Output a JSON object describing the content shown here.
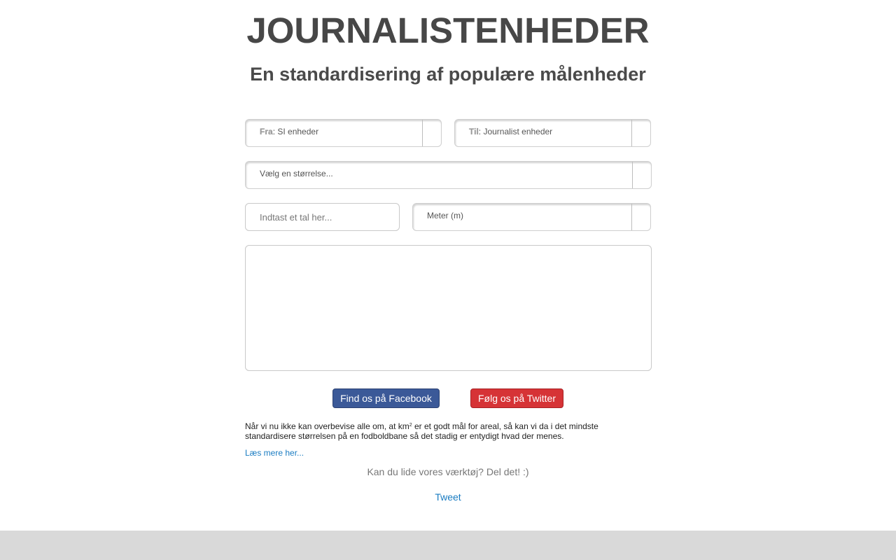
{
  "header": {
    "title": "JOURNALISTENHEDER",
    "subtitle": "En standardisering af populære målenheder"
  },
  "from_select": {
    "prefix": "Fra",
    "value": ": SI enheder"
  },
  "to_select": {
    "prefix": "Til",
    "value": ": Journalist enheder"
  },
  "size_select": {
    "value": "Vælg en størrelse..."
  },
  "number_input": {
    "placeholder": "Indtast et tal her...",
    "value": ""
  },
  "unit_select": {
    "value": "Meter (m)"
  },
  "buttons": {
    "facebook": "Find os på Facebook",
    "twitter": "Følg os på Twitter"
  },
  "description": {
    "part1": "Når vi nu ikke kan overbevise alle om, at km",
    "sup": "2",
    "part2": " er et godt mål for areal, så kan vi da i det mindste standardisere størrelsen på en fodboldbane så det stadig er entydigt hvad der menes."
  },
  "read_more": "Læs mere her...",
  "share_text": "Kan du lide vores værktøj? Del det! :)",
  "tweet_link": "Tweet",
  "colors": {
    "facebook": "#3b5998",
    "twitter": "#d63336",
    "link": "#1a7cc2",
    "footer": "#d9d9d9"
  }
}
